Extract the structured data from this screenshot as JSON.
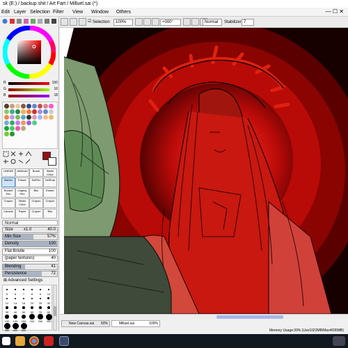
{
  "window": {
    "title": "sk (E:) / backup shit / Art Fart / Milluel.sai (*)"
  },
  "menubar": {
    "items": [
      "Edit",
      "Layer",
      "Selection",
      "Filter",
      "View",
      "Window",
      "Others"
    ]
  },
  "toolbar": {
    "selection_label": "Selection",
    "zoom_value": "100%",
    "rotation_value": "+000°",
    "blend_mode": "Normal",
    "stabilizer_label": "Stabilizer",
    "stabilizer_value": "7"
  },
  "color": {
    "r_label": "R",
    "r_value": "150",
    "g_label": "G",
    "g_value": "16",
    "b_label": "B",
    "b_value": "18",
    "primary": "#961012",
    "secondary": "#ffffff"
  },
  "tools": {
    "row1": [
      "LINEAR",
      "AirBrush",
      "Brush",
      "Water Color"
    ],
    "row2": [
      "Marker",
      "Eraser",
      "SelPen",
      "SelEras"
    ],
    "row3": [
      "Bucket Pen",
      "Legacy Pen",
      "Blur",
      "Eraser"
    ],
    "row4": [
      "Crayon",
      "Water Color",
      "Crayon",
      "Crayon"
    ],
    "row5": [
      "Canvas",
      "Paper",
      "Crayon",
      "Blur"
    ]
  },
  "brush": {
    "mode": "Normal",
    "size_label": "Size",
    "size_mult": "x1.0",
    "size_value": "40.0",
    "min_size_label": "Min Size",
    "min_size_value": "57%",
    "density_label": "Density",
    "density_value": "100",
    "shape": "Flat Bristle",
    "shape_value": "100",
    "texture": "(paper textures)",
    "texture_value": "40",
    "blending_label": "Blending",
    "blending_value": "41",
    "persistence_label": "Persistence",
    "persistence_value": "72",
    "advanced_label": "Advanced Settings",
    "size_presets": [
      "5",
      "6",
      "7",
      "8",
      "9",
      "10",
      "12",
      "14",
      "16",
      "20",
      "25",
      "30",
      "35",
      "40",
      "50",
      "60",
      "70",
      "80",
      "100",
      "120",
      "160",
      "200",
      "250",
      "300",
      "350",
      "400",
      "500"
    ]
  },
  "doctabs": [
    {
      "label": "New Canvas.sai",
      "zoom": "50%"
    },
    {
      "label": "Milluel.sai",
      "zoom": "100%"
    }
  ],
  "statusbar": {
    "memory": "Memory Usage:39% (Use1022MB/Max4095MB)"
  }
}
